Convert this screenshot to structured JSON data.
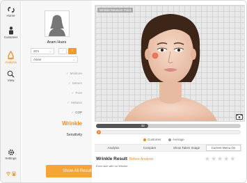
{
  "rail": {
    "home": "Home",
    "customer": "Customer",
    "analysis": "Analysis",
    "view": "View",
    "settings": "Settings"
  },
  "profile": {
    "name": "Aram Hues",
    "age": "20's",
    "ethnicity": "Asian",
    "gender_options": [
      "♂",
      "♀"
    ],
    "selected_gender": "♀"
  },
  "analysis_menu": [
    {
      "label": "Moisture",
      "checked": true
    },
    {
      "label": "Sebum",
      "checked": true
    },
    {
      "label": "Pore",
      "checked": true
    },
    {
      "label": "Melanin",
      "checked": true
    },
    {
      "label": "COP",
      "checked": true
    }
  ],
  "current_item": "Wrinkle",
  "next_item": "Sensitivity",
  "show_all_label": "Show All Results",
  "face_view_label": "Wrinkle Measure Point",
  "timeline": {
    "value": "32",
    "progress": 0.36,
    "marker": "2"
  },
  "legend": {
    "customer": "Customer",
    "average": "Average",
    "customer_color": "#f08a1c",
    "average_color": "#999999"
  },
  "actions": {
    "analysis": "Analysis",
    "compare": "Compare",
    "show_taken_image": "Show Taken Image",
    "current_menu_on": "Current Menu On"
  },
  "result": {
    "title": "Wrinkle Result",
    "subtitle": "Before Analysis",
    "description": "Even skin with no Wrinkle.",
    "stars": 0,
    "star_max": 5
  },
  "colors": {
    "accent": "#f08a1c",
    "button": "#f5a436"
  }
}
